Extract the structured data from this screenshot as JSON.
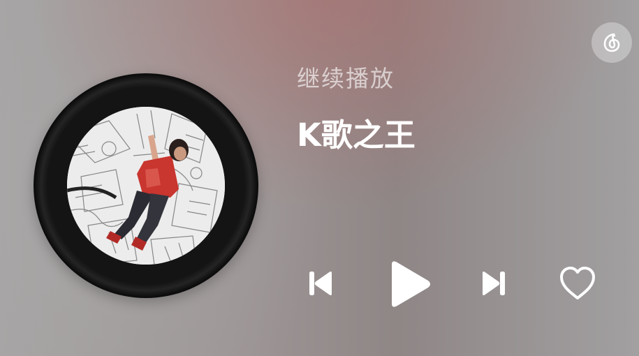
{
  "widget": {
    "status_label": "继续播放",
    "song_title": "K歌之王"
  },
  "icons": {
    "app_logo": "netease-music-logo-icon",
    "prev": "skip-previous-icon",
    "play": "play-icon",
    "next": "skip-next-icon",
    "like": "heart-outline-icon"
  },
  "colors": {
    "text_primary": "#ffffff",
    "text_secondary": "#f0eded"
  }
}
